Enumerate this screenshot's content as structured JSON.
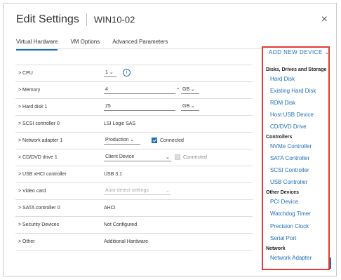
{
  "dialog": {
    "title": "Edit Settings",
    "vm_name": "WIN10-02",
    "close_glyph": "×"
  },
  "tabs": [
    {
      "label": "Virtual Hardware",
      "active": true
    },
    {
      "label": "VM Options",
      "active": false
    },
    {
      "label": "Advanced Parameters",
      "active": false
    }
  ],
  "add_device_label": "ADD NEW DEVICE ⌄",
  "rows": {
    "cpu": {
      "label": "> CPU",
      "value": "1 ⌄",
      "info": "i"
    },
    "memory": {
      "label": "> Memory",
      "value": "4",
      "unit": "GB ⌄",
      "arrow": "⌄"
    },
    "hard_disk": {
      "label": "> Hard disk 1",
      "value": "25",
      "unit": "GB ⌄"
    },
    "scsi": {
      "label": "> SCSI controller 0",
      "value": "LSI Logic SAS"
    },
    "network": {
      "label": "> Network adapter 1",
      "value": "Production ⌄",
      "connected": "Connected"
    },
    "cddvd": {
      "label": "> CD/DVD drive 1",
      "value": "Client Device",
      "arrow": "⌄",
      "connected": "Connected"
    },
    "usb": {
      "label": "> USB xHCI controller",
      "value": "USB 3.1"
    },
    "video": {
      "label": "> Video card",
      "value": "Auto-detect settings",
      "arrow": "⌄"
    },
    "sata": {
      "label": "> SATA controller 0",
      "value": "AHCI"
    },
    "security": {
      "label": "> Security Devices",
      "value": "Not Configured"
    },
    "other": {
      "label": "> Other",
      "value": "Additional Hardware"
    }
  },
  "menu": {
    "group1": "Disks, Drives and Storage",
    "items1": [
      "Hard Disk",
      "Existing Hard Disk",
      "RDM Disk",
      "Host USB Device",
      "CD/DVD Drive"
    ],
    "group2": "Controllers",
    "items2": [
      "NVMe Controller",
      "SATA Controller",
      "SCSI Controller",
      "USB Controller"
    ],
    "group3": "Other Devices",
    "items3": [
      "PCI Device",
      "Watchdog Timer",
      "Precision Clock",
      "Serial Port"
    ],
    "group4": "Network",
    "items4": [
      "Network Adapter"
    ]
  }
}
